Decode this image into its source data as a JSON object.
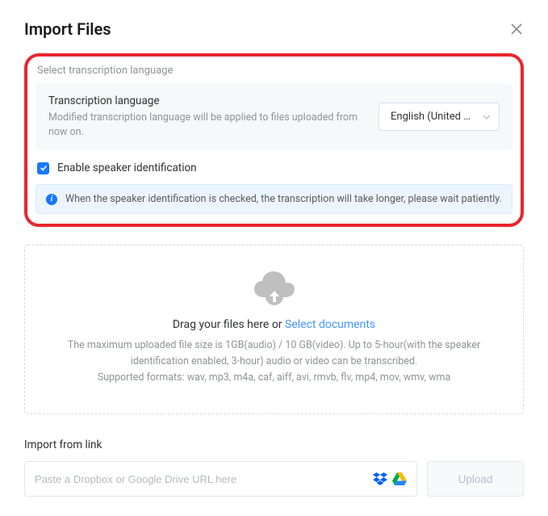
{
  "header": {
    "title": "Import Files"
  },
  "language": {
    "section_label": "Select transcription language",
    "title": "Transcription language",
    "subtitle": "Modified transcription language will be applied to files uploaded from now on.",
    "selected": "English (United S..."
  },
  "speaker": {
    "checkbox_label": "Enable speaker identification",
    "checked": true,
    "info_text": "When the speaker identification is checked, the transcription will take longer, please wait patiently."
  },
  "dropzone": {
    "heading_prefix": "Drag your files here or  ",
    "heading_link": "Select documents",
    "sub1": "The maximum uploaded file size is 1GB(audio) / 10 GB(video). Up to 5-hour(with the speaker identification enabled, 3-hour) audio or video can be transcribed.",
    "sub2": "Supported formats: wav, mp3, m4a, caf, aiff, avi, rmvb, flv, mp4, mov, wmv, wma"
  },
  "import_link": {
    "label": "Import from link",
    "placeholder": "Paste a Dropbox or Google Drive URL here",
    "button": "Upload"
  }
}
